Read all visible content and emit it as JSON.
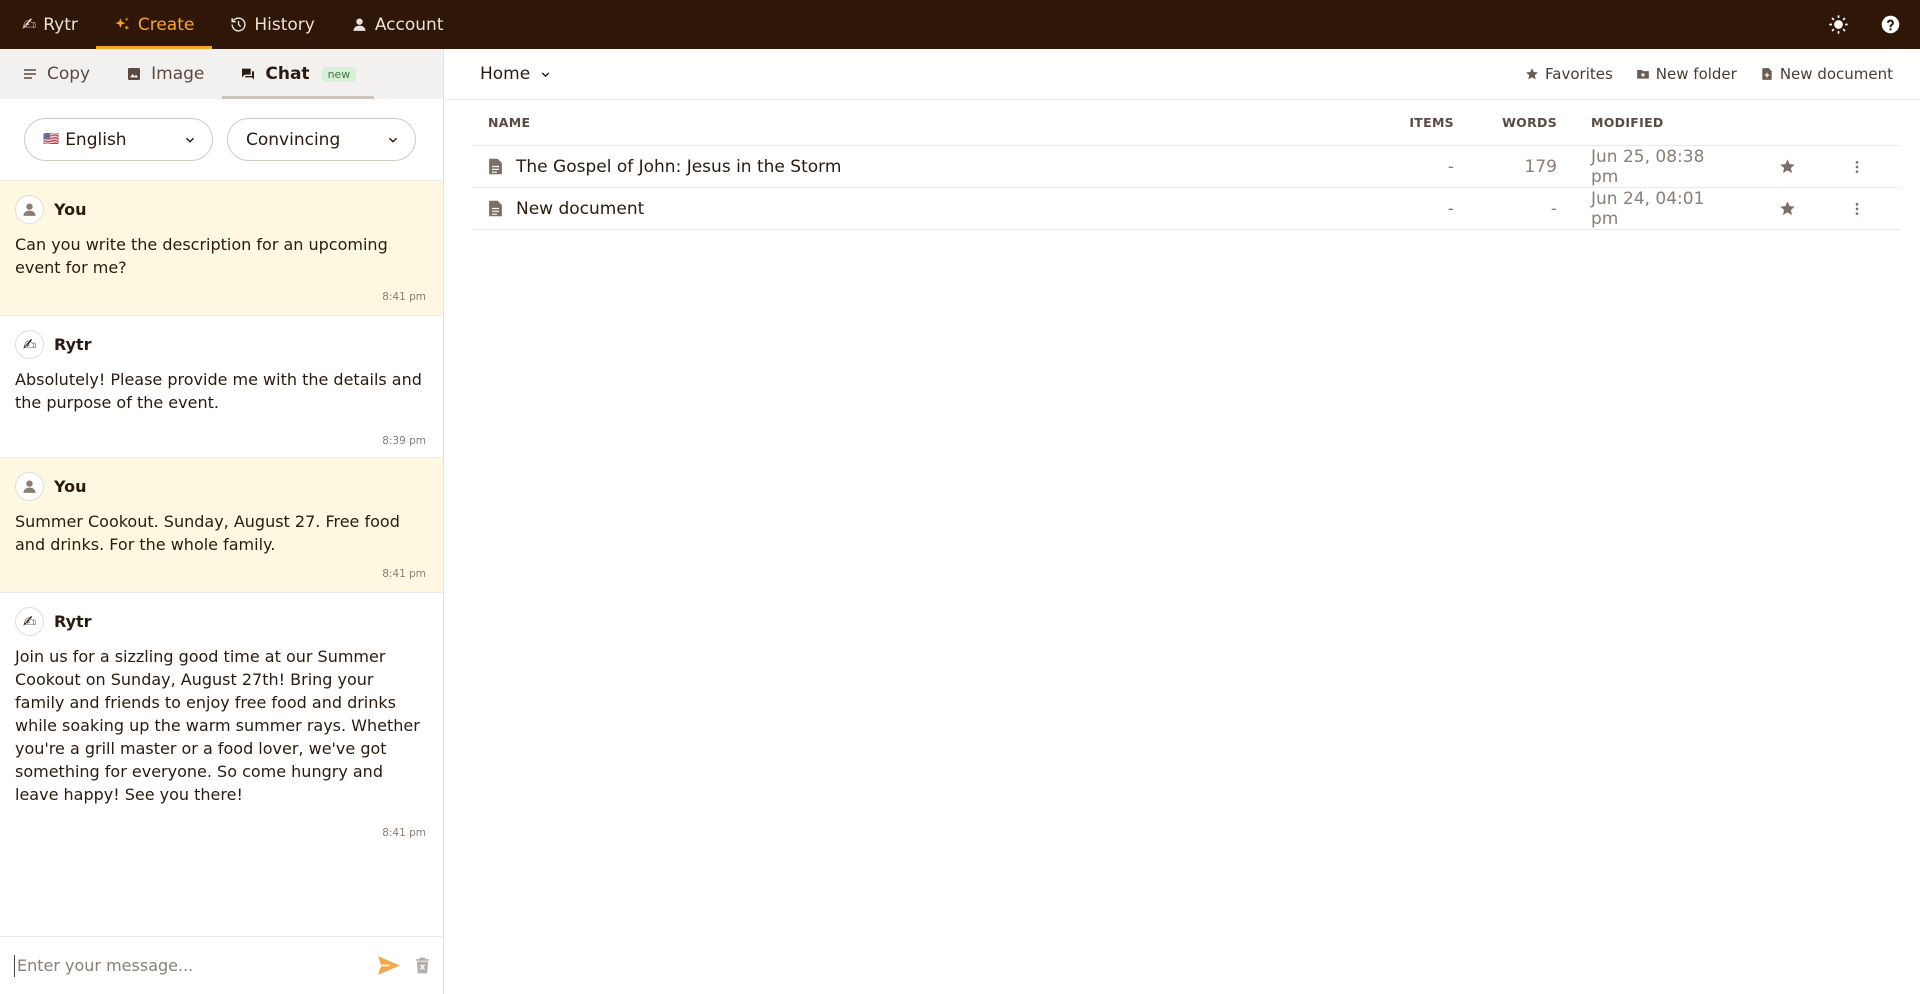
{
  "topnav": {
    "brand": "Rytr",
    "create": "Create",
    "history": "History",
    "account": "Account"
  },
  "left": {
    "tabs": {
      "copy": "Copy",
      "image": "Image",
      "chat": "Chat",
      "chat_badge": "new"
    },
    "language": "English",
    "tone": "Convincing",
    "messages": [
      {
        "author": "You",
        "text": "Can you write the description for an upcoming event for me?",
        "time": "8:41 pm"
      },
      {
        "author": "Rytr",
        "text": "Absolutely! Please provide me with the details and the purpose of the event.",
        "time": "8:39 pm"
      },
      {
        "author": "You",
        "text": "Summer Cookout. Sunday, August 27. Free food and drinks. For the whole family.",
        "time": "8:41 pm"
      },
      {
        "author": "Rytr",
        "text": "Join us for a sizzling good time at our Summer Cookout on Sunday, August 27th! Bring your family and friends to enjoy free food and drinks while soaking up the warm summer rays. Whether you're a grill master or a food lover, we've got something for everyone. So come hungry and leave happy! See you there!",
        "time": "8:41 pm"
      }
    ],
    "composer_placeholder": "Enter your message..."
  },
  "main": {
    "breadcrumb": "Home",
    "toolbar": {
      "favorites": "Favorites",
      "new_folder": "New folder",
      "new_document": "New document"
    },
    "columns": {
      "name": "NAME",
      "items": "ITEMS",
      "words": "WORDS",
      "modified": "MODIFIED"
    },
    "rows": [
      {
        "name": "The Gospel of John: Jesus in the Storm",
        "items": "-",
        "words": "179",
        "modified": "Jun 25, 08:38 pm"
      },
      {
        "name": "New document",
        "items": "-",
        "words": "-",
        "modified": "Jun 24, 04:01 pm"
      }
    ]
  },
  "colors": {
    "topbar": "#301606",
    "accent": "#f6a82a",
    "user_bubble": "#fff8e1"
  }
}
